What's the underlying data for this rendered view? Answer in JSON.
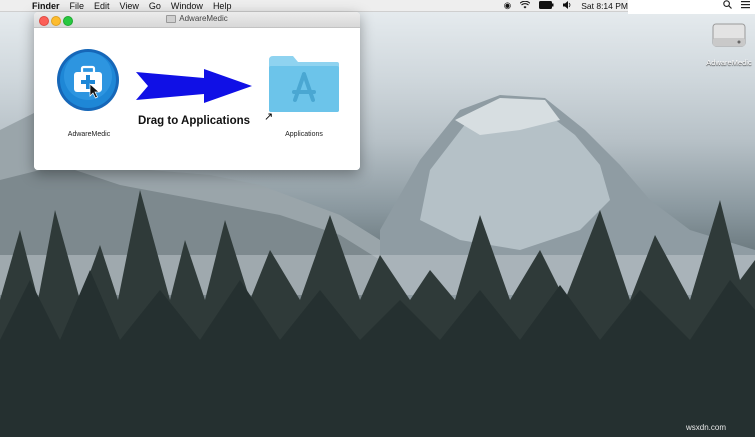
{
  "menubar": {
    "app_name": "Finder",
    "menus": [
      "File",
      "Edit",
      "View",
      "Go",
      "Window",
      "Help"
    ],
    "clock": "Sat 8:14 PM",
    "battery_icon": "battery-icon",
    "wifi_icon": "wifi-icon"
  },
  "window": {
    "title": "AdwareMedic",
    "app_label": "AdwareMedic",
    "drag_text": "Drag to Applications",
    "folder_label": "Applications"
  },
  "desktop": {
    "disk_label": "AdwareMedic"
  },
  "watermark": "wsxdn.com",
  "colors": {
    "arrow_blue": "#1010e6",
    "folder_blue": "#6cc4ea",
    "app_blue": "#1e87d6"
  }
}
